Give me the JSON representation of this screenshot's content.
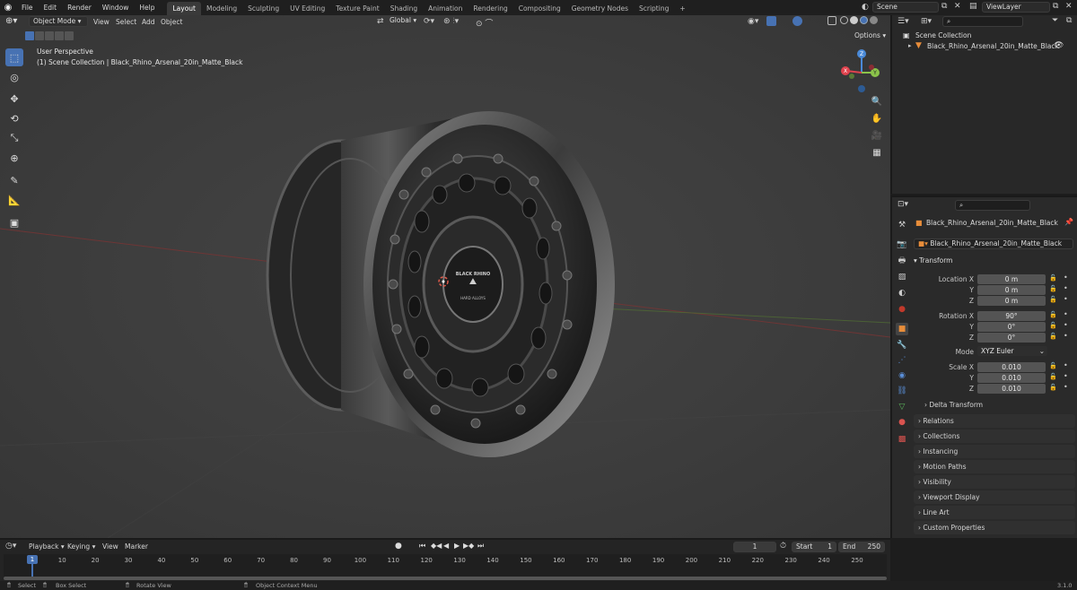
{
  "topbar": {
    "menus": [
      "File",
      "Edit",
      "Render",
      "Window",
      "Help"
    ],
    "workspaces": [
      "Layout",
      "Modeling",
      "Sculpting",
      "UV Editing",
      "Texture Paint",
      "Shading",
      "Animation",
      "Rendering",
      "Compositing",
      "Geometry Nodes",
      "Scripting"
    ],
    "add_tab": "+",
    "scene": "Scene",
    "view_layer": "ViewLayer"
  },
  "viewport": {
    "mode": "Object Mode",
    "menus": [
      "View",
      "Select",
      "Add",
      "Object"
    ],
    "transform_orientation": "Global",
    "options": "Options",
    "perspective": "User Perspective",
    "collection_path": "(1) Scene Collection | Black_Rhino_Arsenal_20in_Matte_Black",
    "gizmo": {
      "x": "X",
      "y": "Y",
      "z": "Z"
    },
    "wheel_logo_text": "BLACK RHINO",
    "wheel_logo_sub": "HARD ALLOYS"
  },
  "outliner": {
    "root": "Scene Collection",
    "object": "Black_Rhino_Arsenal_20in_Matte_Black"
  },
  "properties": {
    "object_name": "Black_Rhino_Arsenal_20in_Matte_Black",
    "data_name": "Black_Rhino_Arsenal_20in_Matte_Black",
    "transform_header": "Transform",
    "location": {
      "label": "Location X",
      "x": "0 m",
      "y": "0 m",
      "z": "0 m"
    },
    "rotation": {
      "label": "Rotation X",
      "x": "90°",
      "y": "0°",
      "z": "0°"
    },
    "mode_label": "Mode",
    "mode_value": "XYZ Euler",
    "scale": {
      "label": "Scale X",
      "x": "0.010",
      "y": "0.010",
      "z": "0.010"
    },
    "axis_y": "Y",
    "axis_z": "Z",
    "delta_transform": "Delta Transform",
    "panels": [
      "Relations",
      "Collections",
      "Instancing",
      "Motion Paths",
      "Visibility",
      "Viewport Display",
      "Line Art",
      "Custom Properties"
    ]
  },
  "timeline": {
    "menus": [
      "Playback",
      "Keying",
      "View",
      "Marker"
    ],
    "current_frame": "1",
    "start_label": "Start",
    "start": "1",
    "end_label": "End",
    "end": "250",
    "ticks": [
      "10",
      "20",
      "30",
      "40",
      "50",
      "60",
      "70",
      "80",
      "90",
      "100",
      "110",
      "120",
      "130",
      "140",
      "150",
      "160",
      "170",
      "180",
      "190",
      "200",
      "210",
      "220",
      "230",
      "240",
      "250"
    ],
    "playhead": "1"
  },
  "statusbar": {
    "select": "Select",
    "box_select": "Box Select",
    "rotate_view": "Rotate View",
    "context_menu": "Object Context Menu",
    "version": "3.1.0"
  },
  "colors": {
    "accent": "#4772b3",
    "x_axis": "#e0434e",
    "y_axis": "#8bc34a",
    "z_axis": "#4a8ad8"
  }
}
